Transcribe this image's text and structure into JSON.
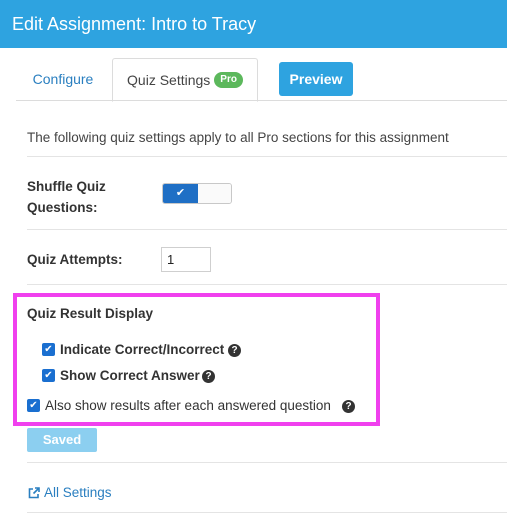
{
  "header": {
    "title": "Edit Assignment: Intro to Tracy"
  },
  "tabs": {
    "configure": "Configure",
    "quiz_settings": "Quiz Settings",
    "pro_badge": "Pro",
    "preview": "Preview"
  },
  "description": "The following quiz settings apply to all Pro sections for this assignment",
  "shuffle": {
    "label_line1": "Shuffle Quiz",
    "label_line2": "Questions:",
    "enabled": true,
    "on_glyph": "✔"
  },
  "attempts": {
    "label": "Quiz Attempts:",
    "value": "1"
  },
  "result_display": {
    "heading": "Quiz Result Display",
    "options": [
      {
        "label": "Indicate Correct/Incorrect",
        "checked": true
      },
      {
        "label": "Show Correct Answer",
        "checked": true
      },
      {
        "label": "Also show results after each answered question",
        "checked": true
      }
    ],
    "help_glyph": "?"
  },
  "saved_button": "Saved",
  "all_settings_link": "All Settings",
  "colors": {
    "header": "#2ea3e0",
    "accent": "#1a6fd0",
    "highlight": "#f040ee",
    "badge": "#5cb85c"
  },
  "icons": [
    "external-link-icon",
    "help-icon",
    "checkmark-icon"
  ]
}
